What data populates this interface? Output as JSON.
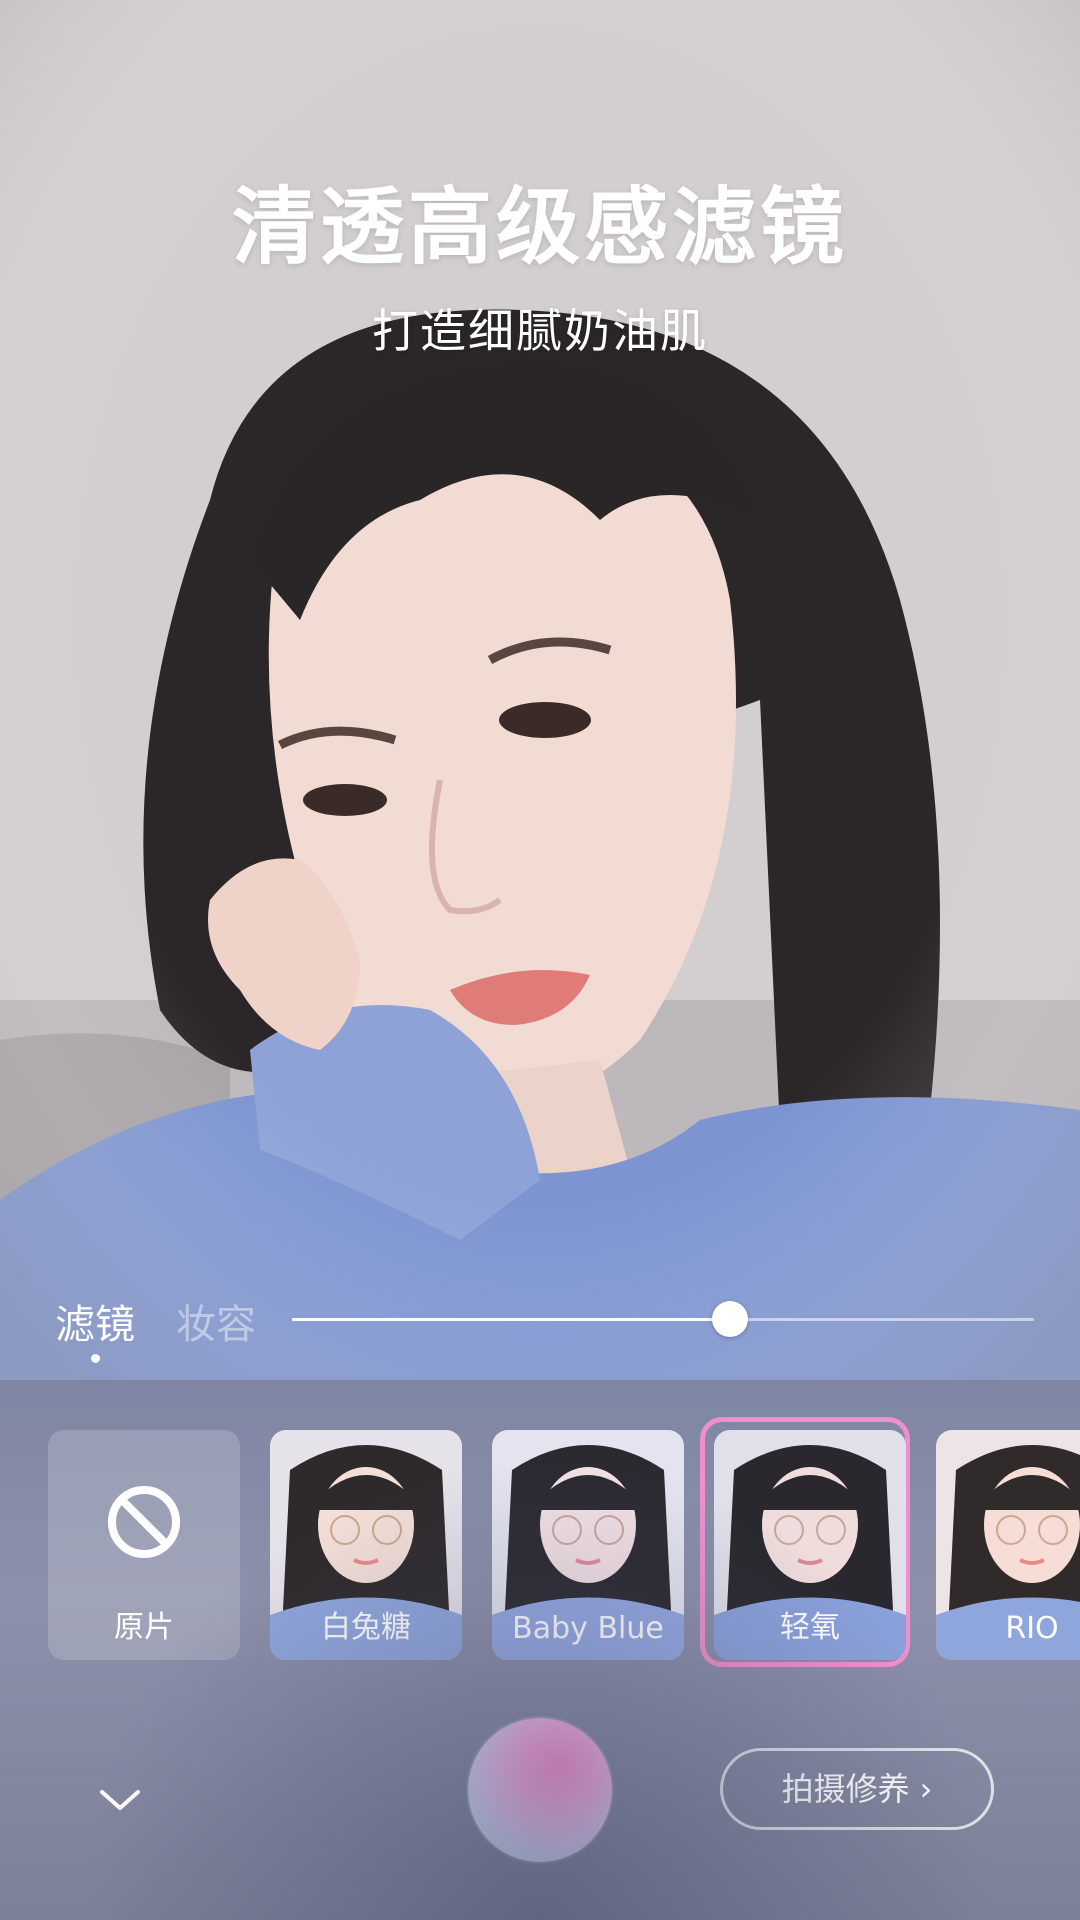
{
  "preview": {
    "headline": "清透高级感滤镜",
    "subline": "打造细腻奶油肌"
  },
  "tabs": {
    "filter": "滤镜",
    "makeup": "妆容",
    "active": "filter"
  },
  "slider": {
    "value": 0.59
  },
  "filters": [
    {
      "label": "原片",
      "icon": "no-filter-icon",
      "selected": false
    },
    {
      "label": "白兔糖",
      "selected": false
    },
    {
      "label": "Baby Blue",
      "selected": false
    },
    {
      "label": "轻氧",
      "selected": true
    },
    {
      "label": "RIO",
      "selected": false
    }
  ],
  "controls": {
    "collapse_icon": "chevron-down-icon",
    "shoot_label": "拍摄修养",
    "shoot_icon": "chevron-right-icon"
  },
  "colors": {
    "selection_ring": "#ef8fcb",
    "panel": "#868ba6",
    "shutter_pink": "#f58fcf",
    "shutter_blue": "#b6e6f4"
  }
}
